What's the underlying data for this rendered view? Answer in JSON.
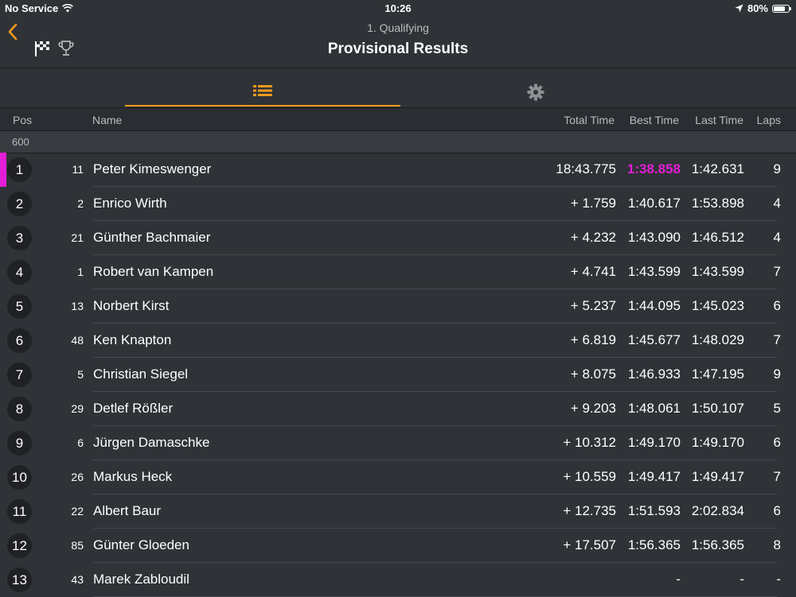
{
  "status": {
    "carrier": "No Service",
    "time": "10:26",
    "battery": "80%",
    "battery_level": 0.8
  },
  "header": {
    "session": "1. Qualifying",
    "title": "Provisional Results"
  },
  "tabs": [
    {
      "name": "list",
      "active": true
    },
    {
      "name": "settings",
      "active": false
    }
  ],
  "columns": {
    "pos": "Pos",
    "name": "Name",
    "total": "Total Time",
    "best": "Best Time",
    "last": "Last Time",
    "laps": "Laps"
  },
  "group": "600",
  "colors": {
    "accent": "#f19a1e",
    "fastest": "#e31ed6",
    "background": "#2f3236"
  },
  "results": [
    {
      "pos": "1",
      "no": "11",
      "name": "Peter Kimeswenger",
      "total": "18:43.775",
      "best": "1:38.858",
      "last": "1:42.631",
      "laps": "9",
      "fastest": true
    },
    {
      "pos": "2",
      "no": "2",
      "name": "Enrico Wirth",
      "total": "+ 1.759",
      "best": "1:40.617",
      "last": "1:53.898",
      "laps": "4"
    },
    {
      "pos": "3",
      "no": "21",
      "name": "Günther Bachmaier",
      "total": "+ 4.232",
      "best": "1:43.090",
      "last": "1:46.512",
      "laps": "4"
    },
    {
      "pos": "4",
      "no": "1",
      "name": "Robert van Kampen",
      "total": "+ 4.741",
      "best": "1:43.599",
      "last": "1:43.599",
      "laps": "7"
    },
    {
      "pos": "5",
      "no": "13",
      "name": "Norbert Kirst",
      "total": "+ 5.237",
      "best": "1:44.095",
      "last": "1:45.023",
      "laps": "6"
    },
    {
      "pos": "6",
      "no": "48",
      "name": "Ken Knapton",
      "total": "+ 6.819",
      "best": "1:45.677",
      "last": "1:48.029",
      "laps": "7"
    },
    {
      "pos": "7",
      "no": "5",
      "name": "Christian Siegel",
      "total": "+ 8.075",
      "best": "1:46.933",
      "last": "1:47.195",
      "laps": "9"
    },
    {
      "pos": "8",
      "no": "29",
      "name": "Detlef Rößler",
      "total": "+ 9.203",
      "best": "1:48.061",
      "last": "1:50.107",
      "laps": "5"
    },
    {
      "pos": "9",
      "no": "6",
      "name": "Jürgen Damaschke",
      "total": "+ 10.312",
      "best": "1:49.170",
      "last": "1:49.170",
      "laps": "6"
    },
    {
      "pos": "10",
      "no": "26",
      "name": "Markus Heck",
      "total": "+ 10.559",
      "best": "1:49.417",
      "last": "1:49.417",
      "laps": "7"
    },
    {
      "pos": "11",
      "no": "22",
      "name": "Albert Baur",
      "total": "+ 12.735",
      "best": "1:51.593",
      "last": "2:02.834",
      "laps": "6"
    },
    {
      "pos": "12",
      "no": "85",
      "name": "Günter Gloeden",
      "total": "+ 17.507",
      "best": "1:56.365",
      "last": "1:56.365",
      "laps": "8"
    },
    {
      "pos": "13",
      "no": "43",
      "name": "Marek Zabloudil",
      "total": "",
      "best": "-",
      "last": "-",
      "laps": "-"
    }
  ]
}
